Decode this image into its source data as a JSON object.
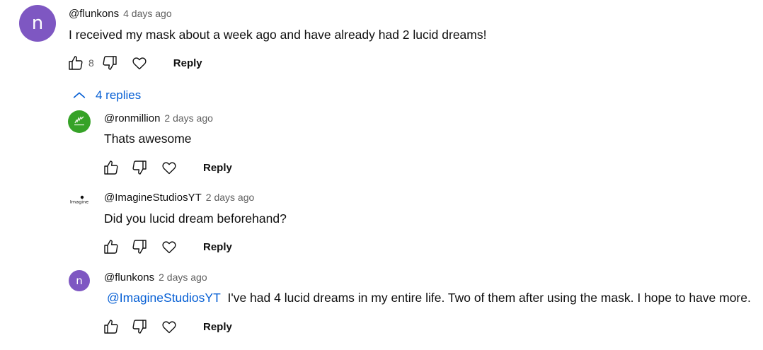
{
  "comment": {
    "avatar_letter": "n",
    "author": "@flunkons",
    "timestamp": "4 days ago",
    "text": "I received my mask about a week ago and have already had 2 lucid dreams!",
    "like_count": "8",
    "reply_label": "Reply"
  },
  "replies_toggle": {
    "label": "4 replies"
  },
  "replies": [
    {
      "author": "@ronmillion",
      "timestamp": "2 days ago",
      "text": "Thats awesome",
      "reply_label": "Reply"
    },
    {
      "avatar_text": "Imagine",
      "author": "@ImagineStudiosYT",
      "timestamp": "2 days ago",
      "text": "Did you lucid dream beforehand?",
      "reply_label": "Reply"
    },
    {
      "avatar_letter": "n",
      "author": "@flunkons",
      "timestamp": "2 days ago",
      "mention": "@ImagineStudiosYT",
      "text": "I've had 4 lucid dreams in my entire life. Two of them after using the mask. I hope to have more.",
      "reply_label": "Reply"
    }
  ],
  "colors": {
    "avatar_purple": "#7e57c2",
    "avatar_green": "#36a227",
    "link_blue": "#065fd4",
    "secondary_text": "#606060"
  }
}
